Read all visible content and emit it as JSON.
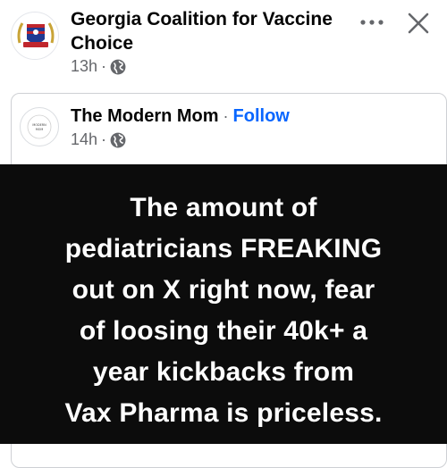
{
  "post": {
    "page_name": "Georgia Coalition for Vaccine Choice",
    "timestamp": "13h",
    "separator": "·",
    "privacy_icon": "globe-icon",
    "more_icon": "more-options-icon",
    "close_icon": "close-icon"
  },
  "shared_post": {
    "page_name": "The Modern Mom",
    "separator": "·",
    "follow_label": "Follow",
    "timestamp": "14h",
    "privacy_icon": "globe-icon",
    "avatar_text": "MODERN MOM"
  },
  "image_text": {
    "lines": [
      "The amount of",
      "pediatricians FREAKING",
      "out on X right now, fear",
      "of loosing their 40k+ a",
      "year kickbacks from",
      "Vax Pharma is priceless."
    ]
  },
  "colors": {
    "name_text": "#050505",
    "meta_text": "#65676b",
    "follow_blue": "#0866ff",
    "image_bg": "#0c0c0c",
    "image_text": "#ffffff"
  }
}
